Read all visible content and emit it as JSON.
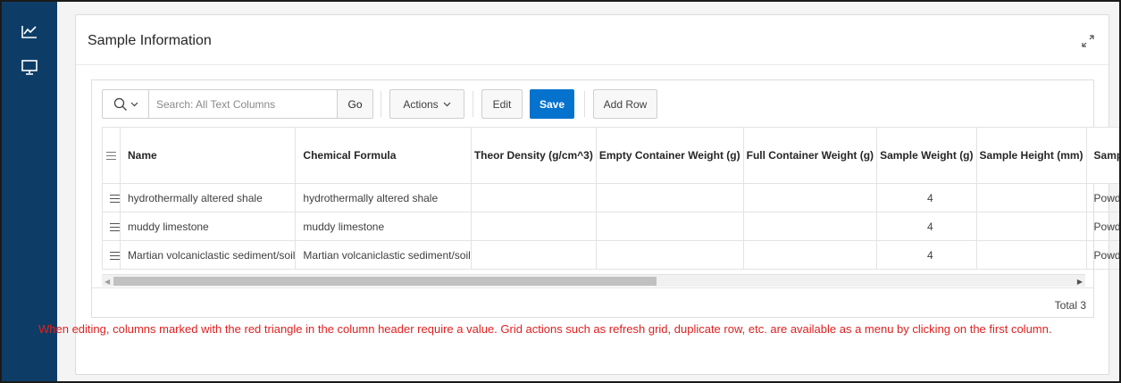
{
  "sidebar": {
    "items": [
      {
        "icon": "line-chart-icon"
      },
      {
        "icon": "desktop-icon"
      }
    ]
  },
  "region": {
    "title": "Sample Information",
    "expand_icon": "expand-icon"
  },
  "toolbar": {
    "search_placeholder": "Search: All Text Columns",
    "search_value": "",
    "go_label": "Go",
    "actions_label": "Actions",
    "edit_label": "Edit",
    "save_label": "Save",
    "add_row_label": "Add Row"
  },
  "grid": {
    "columns": [
      {
        "label": ""
      },
      {
        "label": "Name"
      },
      {
        "label": "Chemical Formula"
      },
      {
        "label": "Theor Density (g/cm^3)"
      },
      {
        "label": "Empty Container Weight (g)"
      },
      {
        "label": "Full Container Weight (g)"
      },
      {
        "label": "Sample Weight (g)"
      },
      {
        "label": "Sample Height (mm)"
      },
      {
        "label": "Sample Form"
      }
    ],
    "rows": [
      {
        "name": "hydrothermally altered shale",
        "formula": "hydrothermally altered shale",
        "density": "",
        "empty_weight": "",
        "full_weight": "",
        "sample_weight": "4",
        "sample_height": "",
        "form": "Powder"
      },
      {
        "name": "muddy limestone",
        "formula": "muddy limestone",
        "density": "",
        "empty_weight": "",
        "full_weight": "",
        "sample_weight": "4",
        "sample_height": "",
        "form": "Powder"
      },
      {
        "name": "Martian volcaniclastic sediment/soil",
        "formula": "Martian volcaniclastic sediment/soil",
        "density": "",
        "empty_weight": "",
        "full_weight": "",
        "sample_weight": "4",
        "sample_height": "",
        "form": "Powder"
      }
    ],
    "total": "Total 3"
  },
  "note": "When editing, columns marked with the red triangle in the column header require a value. Grid actions such as refresh grid, duplicate row, etc. are available as a menu by clicking on the first column.",
  "colors": {
    "sidebar": "#0d3d67",
    "primary_button": "#0572ce",
    "note_text": "#e02020"
  }
}
